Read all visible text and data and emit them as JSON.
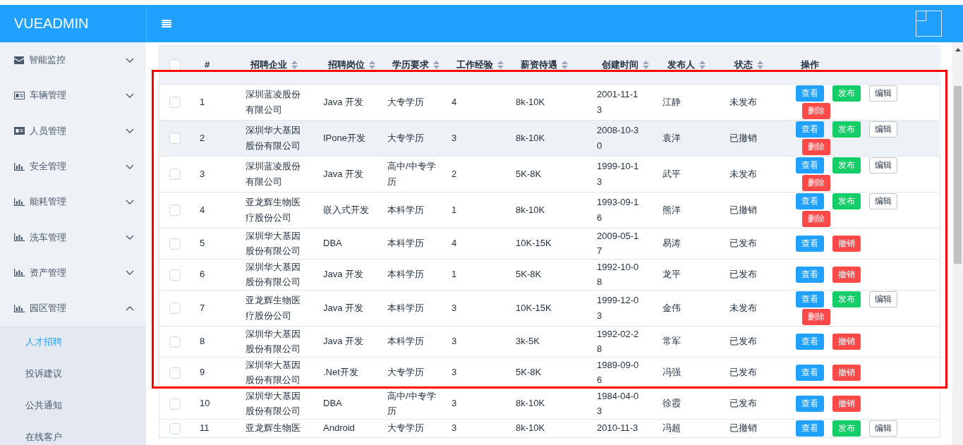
{
  "logo": "VUEADMIN",
  "sidebar": {
    "items": [
      {
        "label": "智能监控",
        "kind": "envelope",
        "expanded": false
      },
      {
        "label": "车辆管理",
        "kind": "card",
        "expanded": false
      },
      {
        "label": "人员管理",
        "kind": "card-dark",
        "expanded": false
      },
      {
        "label": "安全管理",
        "kind": "chart",
        "expanded": false
      },
      {
        "label": "能耗管理",
        "kind": "chart",
        "expanded": false
      },
      {
        "label": "洗车管理",
        "kind": "chart",
        "expanded": false
      },
      {
        "label": "资产管理",
        "kind": "chart",
        "expanded": false
      },
      {
        "label": "园区管理",
        "kind": "chart",
        "expanded": true,
        "children": [
          {
            "label": "人才招聘",
            "selected": true
          },
          {
            "label": "投诉建议",
            "selected": false
          },
          {
            "label": "公共通知",
            "selected": false
          },
          {
            "label": "在线客户",
            "selected": false
          }
        ]
      }
    ]
  },
  "table": {
    "select_all": {
      "checked": false
    },
    "columns": [
      {
        "label": "#",
        "sortable": false
      },
      {
        "label": "招聘企业",
        "sortable": true
      },
      {
        "label": "招聘岗位",
        "sortable": true
      },
      {
        "label": "学历要求",
        "sortable": true
      },
      {
        "label": "工作经验",
        "sortable": true
      },
      {
        "label": "薪资待遇",
        "sortable": true
      },
      {
        "label": "创建时间",
        "sortable": true
      },
      {
        "label": "发布人",
        "sortable": true
      },
      {
        "label": "状态",
        "sortable": true
      },
      {
        "label": "操作",
        "sortable": false
      }
    ],
    "rows": [
      {
        "checked": false,
        "highlighted": false,
        "cells": [
          "1",
          "深圳蓝凌股份有限公司",
          "Java 开发",
          "大专学历",
          "4",
          "8k-10K",
          "2001-11-13",
          "江静",
          "未发布"
        ],
        "actions": [
          {
            "label": "查看",
            "kind": "view"
          },
          {
            "label": "发布",
            "kind": "publish"
          },
          {
            "label": "编辑",
            "kind": "edit"
          },
          {
            "label": "删除",
            "kind": "danger"
          }
        ]
      },
      {
        "checked": false,
        "highlighted": true,
        "cells": [
          "2",
          "深圳华大基因股份有限公司",
          "IPone开发",
          "大专学历",
          "3",
          "8k-10K",
          "2008-10-30",
          "袁洋",
          "已撤销"
        ],
        "actions": [
          {
            "label": "查看",
            "kind": "view"
          },
          {
            "label": "发布",
            "kind": "publish"
          },
          {
            "label": "编辑",
            "kind": "edit"
          },
          {
            "label": "删除",
            "kind": "danger"
          }
        ]
      },
      {
        "checked": false,
        "highlighted": false,
        "cells": [
          "3",
          "深圳蓝凌股份有限公司",
          "Java 开发",
          "高中/中专学历",
          "2",
          "5K-8K",
          "1999-10-13",
          "武平",
          "未发布"
        ],
        "actions": [
          {
            "label": "查看",
            "kind": "view"
          },
          {
            "label": "发布",
            "kind": "publish"
          },
          {
            "label": "编辑",
            "kind": "edit"
          },
          {
            "label": "删除",
            "kind": "danger"
          }
        ]
      },
      {
        "checked": false,
        "highlighted": false,
        "cells": [
          "4",
          "亚龙辉生物医疗股份公司",
          "嵌入式开发",
          "本科学历",
          "1",
          "8k-10K",
          "1993-09-16",
          "熊洋",
          "已撤销"
        ],
        "actions": [
          {
            "label": "查看",
            "kind": "view"
          },
          {
            "label": "发布",
            "kind": "publish"
          },
          {
            "label": "编辑",
            "kind": "edit"
          },
          {
            "label": "删除",
            "kind": "danger"
          }
        ]
      },
      {
        "checked": false,
        "highlighted": false,
        "cells": [
          "5",
          "深圳华大基因股份有限公司",
          "DBA",
          "本科学历",
          "4",
          "10K-15K",
          "2009-05-17",
          "易涛",
          "已发布"
        ],
        "actions": [
          {
            "label": "查看",
            "kind": "view"
          },
          {
            "label": "撤销",
            "kind": "danger"
          }
        ]
      },
      {
        "checked": false,
        "highlighted": false,
        "cells": [
          "6",
          "深圳华大基因股份有限公司",
          "Java 开发",
          "本科学历",
          "1",
          "5K-8K",
          "1992-10-08",
          "龙平",
          "已发布"
        ],
        "actions": [
          {
            "label": "查看",
            "kind": "view"
          },
          {
            "label": "撤销",
            "kind": "danger"
          }
        ]
      },
      {
        "checked": false,
        "highlighted": false,
        "cells": [
          "7",
          "亚龙辉生物医疗股份公司",
          "Java 开发",
          "本科学历",
          "3",
          "10K-15K",
          "1999-12-03",
          "金伟",
          "未发布"
        ],
        "actions": [
          {
            "label": "查看",
            "kind": "view"
          },
          {
            "label": "发布",
            "kind": "publish"
          },
          {
            "label": "编辑",
            "kind": "edit"
          },
          {
            "label": "删除",
            "kind": "danger"
          }
        ]
      },
      {
        "checked": false,
        "highlighted": false,
        "cells": [
          "8",
          "深圳华大基因股份有限公司",
          "Java 开发",
          "本科学历",
          "3",
          "3k-5K",
          "1992-02-28",
          "常军",
          "已发布"
        ],
        "actions": [
          {
            "label": "查看",
            "kind": "view"
          },
          {
            "label": "撤销",
            "kind": "danger"
          }
        ]
      },
      {
        "checked": false,
        "highlighted": false,
        "cells": [
          "9",
          "深圳华大基因股份有限公司",
          ".Net开发",
          "大专学历",
          "3",
          "5K-8K",
          "1989-09-06",
          "冯强",
          "已发布"
        ],
        "actions": [
          {
            "label": "查看",
            "kind": "view"
          },
          {
            "label": "撤销",
            "kind": "danger"
          }
        ]
      },
      {
        "checked": false,
        "highlighted": false,
        "cells": [
          "10",
          "深圳华大基因股份有限公司",
          "DBA",
          "高中/中专学历",
          "3",
          "8k-10K",
          "1984-04-03",
          "徐霞",
          "已发布"
        ],
        "actions": [
          {
            "label": "查看",
            "kind": "view"
          },
          {
            "label": "撤销",
            "kind": "danger"
          }
        ]
      },
      {
        "checked": false,
        "highlighted": false,
        "cells": [
          "11",
          "亚龙辉生物医",
          "Android",
          "大专学历",
          "3",
          "8k-10K",
          "2010-11-3",
          "冯超",
          "已撤销"
        ],
        "actions": [
          {
            "label": "查看",
            "kind": "view"
          },
          {
            "label": "发布",
            "kind": "publish"
          },
          {
            "label": "编辑",
            "kind": "edit"
          }
        ]
      }
    ]
  }
}
